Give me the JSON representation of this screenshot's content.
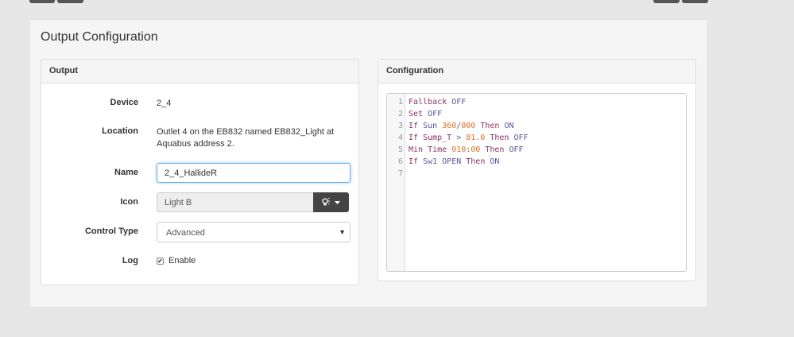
{
  "page": {
    "title": "Output Configuration"
  },
  "output_panel": {
    "heading": "Output",
    "device": {
      "label": "Device",
      "value": "2_4"
    },
    "location": {
      "label": "Location",
      "value": "Outlet 4 on the EB832 named EB832_Light at Aquabus address 2."
    },
    "name": {
      "label": "Name",
      "value": "2_4_HallideR"
    },
    "icon": {
      "label": "Icon",
      "value": "Light B",
      "button_icon": "lightbulb-icon"
    },
    "control_type": {
      "label": "Control Type",
      "value": "Advanced"
    },
    "log": {
      "label": "Log",
      "checkbox_label": "Enable",
      "checked": true
    }
  },
  "config_panel": {
    "heading": "Configuration",
    "code_lines": [
      {
        "num": "1",
        "tokens": [
          {
            "t": "Fallback ",
            "c": "var"
          },
          {
            "t": "OFF",
            "c": "kw"
          }
        ]
      },
      {
        "num": "2",
        "tokens": [
          {
            "t": "Set ",
            "c": "var"
          },
          {
            "t": "OFF",
            "c": "kw"
          }
        ]
      },
      {
        "num": "3",
        "tokens": [
          {
            "t": "If ",
            "c": "var"
          },
          {
            "t": "Sun ",
            "c": "kw"
          },
          {
            "t": "360",
            "c": "num"
          },
          {
            "t": "/",
            "c": "kw"
          },
          {
            "t": "000",
            "c": "num"
          },
          {
            "t": " Then ",
            "c": "var"
          },
          {
            "t": "ON",
            "c": "kw"
          }
        ]
      },
      {
        "num": "4",
        "tokens": [
          {
            "t": "If ",
            "c": "var"
          },
          {
            "t": "Sump_T",
            "c": "var"
          },
          {
            "t": " > ",
            "c": "kw"
          },
          {
            "t": "81.0",
            "c": "num"
          },
          {
            "t": " Then ",
            "c": "var"
          },
          {
            "t": "OFF",
            "c": "kw"
          }
        ]
      },
      {
        "num": "5",
        "tokens": [
          {
            "t": "Min Time ",
            "c": "var"
          },
          {
            "t": "010",
            "c": "num"
          },
          {
            "t": ":",
            "c": "kw"
          },
          {
            "t": "00",
            "c": "num"
          },
          {
            "t": " Then ",
            "c": "var"
          },
          {
            "t": "OFF",
            "c": "kw"
          }
        ]
      },
      {
        "num": "6",
        "tokens": [
          {
            "t": "If ",
            "c": "var"
          },
          {
            "t": "Sw1 ",
            "c": "kw"
          },
          {
            "t": "OPEN ",
            "c": "kw"
          },
          {
            "t": "Then ",
            "c": "var"
          },
          {
            "t": "ON",
            "c": "kw"
          }
        ]
      },
      {
        "num": "7",
        "tokens": []
      }
    ]
  },
  "colors": {
    "keyword": "#555599",
    "number": "#e07020",
    "variable": "#883366",
    "focus": "#66afe9"
  }
}
